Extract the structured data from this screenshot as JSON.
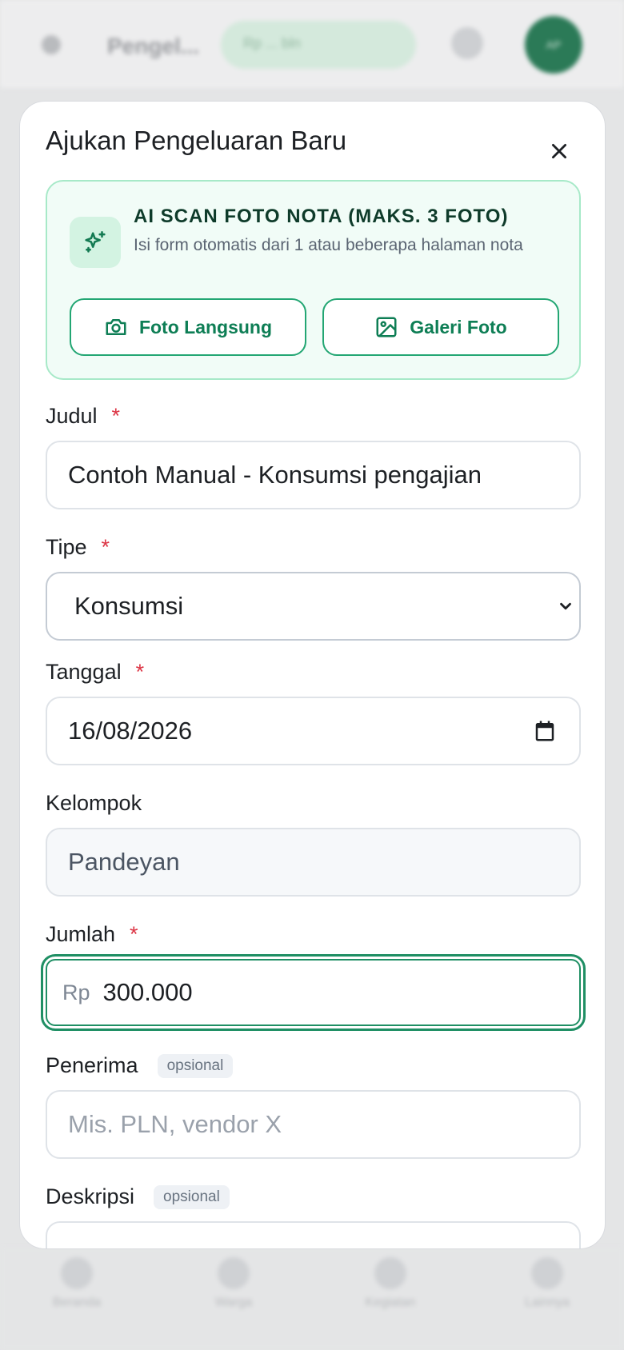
{
  "background": {
    "header_title": "Pengel...",
    "period_pill": "Rp ... bln",
    "avatar_initials": "AP",
    "nav": [
      "Beranda",
      "Warga",
      "Kegiatan",
      "Lainnya"
    ]
  },
  "modal": {
    "title": "Ajukan Pengeluaran Baru",
    "scan": {
      "title": "AI SCAN FOTO NOTA (MAKS. 3 FOTO)",
      "description": "Isi form otomatis dari 1 atau beberapa halaman nota",
      "camera_label": "Foto Langsung",
      "gallery_label": "Galeri Foto"
    },
    "fields": {
      "judul": {
        "label": "Judul",
        "required": "*",
        "value": "Contoh Manual - Konsumsi pengajian"
      },
      "tipe": {
        "label": "Tipe",
        "required": "*",
        "value": "Konsumsi"
      },
      "tanggal": {
        "label": "Tanggal",
        "required": "*",
        "value": "16/08/2026"
      },
      "kelompok": {
        "label": "Kelompok",
        "value": "Pandeyan"
      },
      "jumlah": {
        "label": "Jumlah",
        "required": "*",
        "prefix": "Rp",
        "value": "300.000"
      },
      "penerima": {
        "label": "Penerima",
        "optional": "opsional",
        "placeholder": "Mis. PLN, vendor X"
      },
      "deskripsi": {
        "label": "Deskripsi",
        "optional": "opsional"
      }
    }
  },
  "colors": {
    "accent": "#1f8f64",
    "required": "#dc3545",
    "scan_bg": "#f1fcf7",
    "scan_border": "#a7e9c8"
  }
}
